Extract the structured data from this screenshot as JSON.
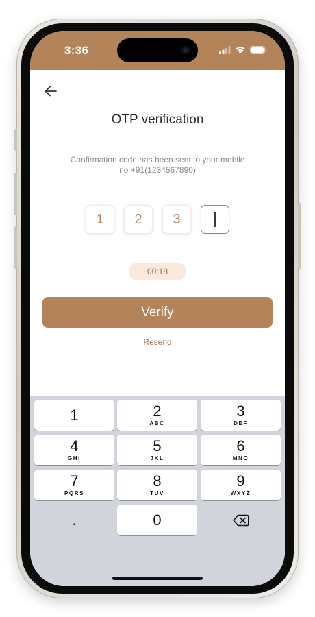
{
  "status_bar": {
    "time": "3:36",
    "icons": [
      "signal-bars-icon",
      "wifi-icon",
      "battery-icon"
    ],
    "background": "#b38359"
  },
  "header": {
    "back_icon": "arrow-left-icon",
    "title": "OTP verification"
  },
  "message": {
    "line1": "Confirmation code has been sent to your mobile",
    "line2": "no +91(1234567890)"
  },
  "otp": {
    "digits": [
      "1",
      "2",
      "3",
      ""
    ],
    "active_index": 3
  },
  "timer": {
    "value": "00:18"
  },
  "actions": {
    "verify_label": "Verify",
    "resend_label": "Resend"
  },
  "keyboard": {
    "keys": [
      {
        "num": "1",
        "letters": ""
      },
      {
        "num": "2",
        "letters": "ABC"
      },
      {
        "num": "3",
        "letters": "DEF"
      },
      {
        "num": "4",
        "letters": "GHI"
      },
      {
        "num": "5",
        "letters": "JKL"
      },
      {
        "num": "6",
        "letters": "MNO"
      },
      {
        "num": "7",
        "letters": "PQRS"
      },
      {
        "num": "8",
        "letters": "TUV"
      },
      {
        "num": "9",
        "letters": "WXYZ"
      },
      {
        "num": "0",
        "letters": ""
      }
    ],
    "dot_label": ".",
    "delete_icon": "backspace-icon"
  },
  "colors": {
    "accent": "#b38359",
    "timer_bg": "#fbeadb",
    "keyboard_bg": "#d1d4da"
  }
}
